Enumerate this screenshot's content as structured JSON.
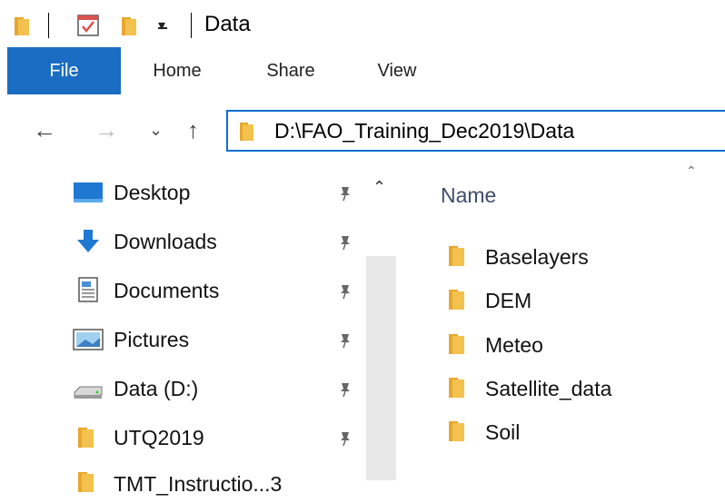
{
  "window": {
    "title": "Data"
  },
  "ribbon": {
    "tabs": [
      "File",
      "Home",
      "Share",
      "View"
    ]
  },
  "address": {
    "path": "D:\\FAO_Training_Dec2019\\Data"
  },
  "nav": {
    "items": [
      {
        "label": "Desktop",
        "icon": "desktop-icon"
      },
      {
        "label": "Downloads",
        "icon": "downloads-icon"
      },
      {
        "label": "Documents",
        "icon": "documents-icon"
      },
      {
        "label": "Pictures",
        "icon": "pictures-icon"
      },
      {
        "label": "Data (D:)",
        "icon": "drive-icon"
      },
      {
        "label": "UTQ2019",
        "icon": "folder-icon"
      },
      {
        "label": "TMT_Instructio...3",
        "icon": "folder-icon"
      }
    ]
  },
  "content": {
    "column_header": "Name",
    "files": [
      "Baselayers",
      "DEM",
      "Meteo",
      "Satellite_data",
      "Soil"
    ]
  },
  "colors": {
    "accent": "#1a6dc2",
    "folder": "#f2c14e",
    "address_border": "#0a6ecf"
  }
}
